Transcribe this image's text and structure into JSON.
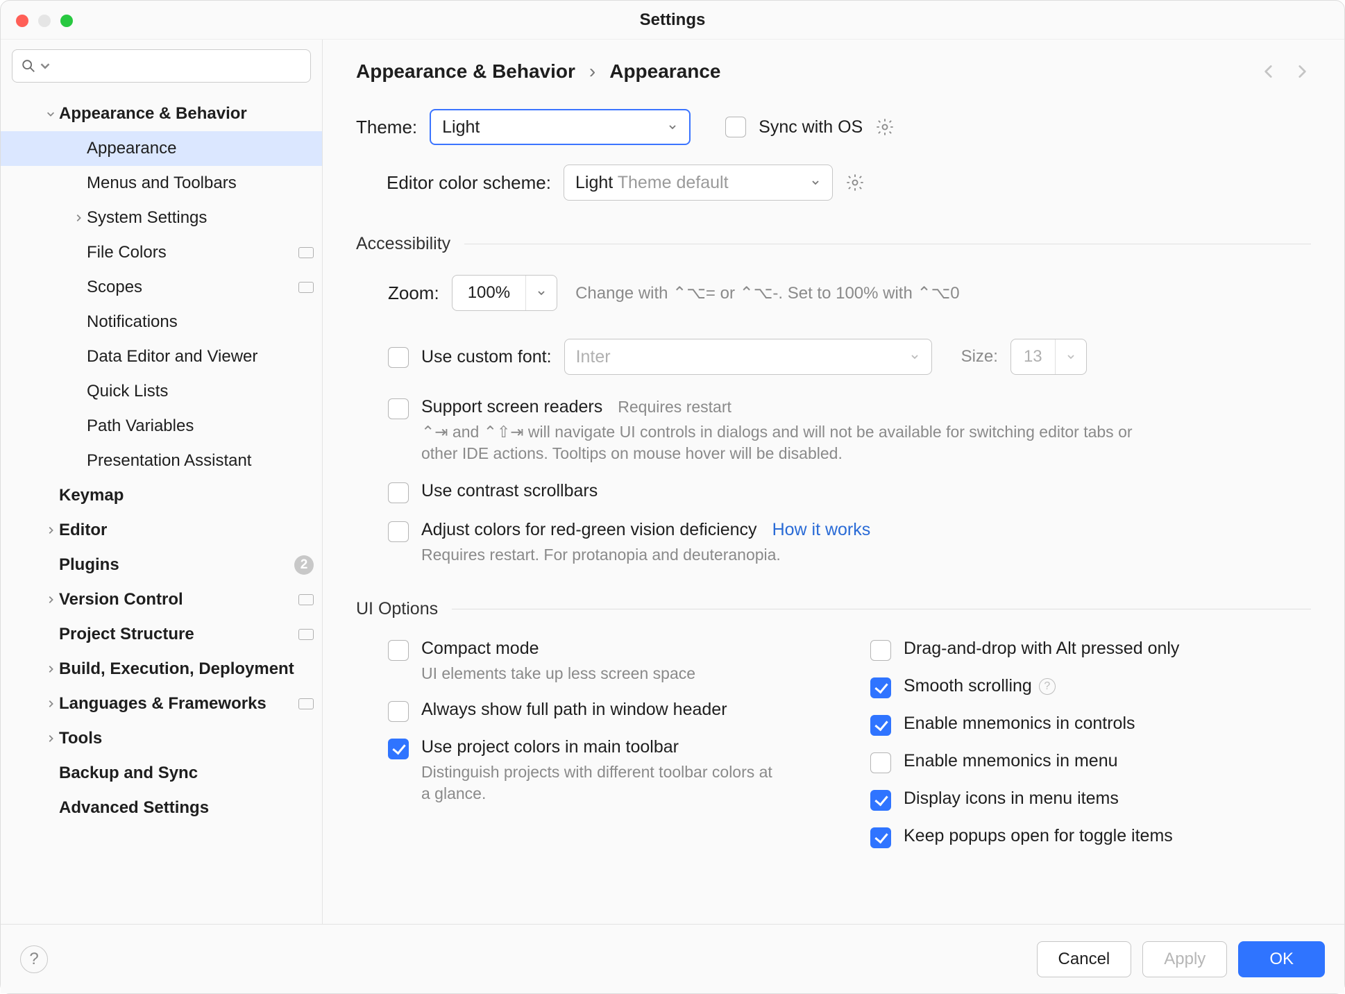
{
  "window": {
    "title": "Settings"
  },
  "search": {
    "placeholder": ""
  },
  "sidebar": [
    {
      "label": "Appearance & Behavior",
      "depth": 1,
      "expanded": true,
      "bold": true,
      "hasChildren": true
    },
    {
      "label": "Appearance",
      "depth": 2,
      "selected": true
    },
    {
      "label": "Menus and Toolbars",
      "depth": 2
    },
    {
      "label": "System Settings",
      "depth": 2,
      "hasChildren": true
    },
    {
      "label": "File Colors",
      "depth": 2,
      "tag": true
    },
    {
      "label": "Scopes",
      "depth": 2,
      "tag": true
    },
    {
      "label": "Notifications",
      "depth": 2
    },
    {
      "label": "Data Editor and Viewer",
      "depth": 2
    },
    {
      "label": "Quick Lists",
      "depth": 2
    },
    {
      "label": "Path Variables",
      "depth": 2
    },
    {
      "label": "Presentation Assistant",
      "depth": 2
    },
    {
      "label": "Keymap",
      "depth": 1,
      "bold": true
    },
    {
      "label": "Editor",
      "depth": 1,
      "bold": true,
      "hasChildren": true
    },
    {
      "label": "Plugins",
      "depth": 1,
      "bold": true,
      "count": "2"
    },
    {
      "label": "Version Control",
      "depth": 1,
      "bold": true,
      "hasChildren": true,
      "tag": true
    },
    {
      "label": "Project Structure",
      "depth": 1,
      "bold": true,
      "tag": true
    },
    {
      "label": "Build, Execution, Deployment",
      "depth": 1,
      "bold": true,
      "hasChildren": true
    },
    {
      "label": "Languages & Frameworks",
      "depth": 1,
      "bold": true,
      "hasChildren": true,
      "tag": true
    },
    {
      "label": "Tools",
      "depth": 1,
      "bold": true,
      "hasChildren": true
    },
    {
      "label": "Backup and Sync",
      "depth": 1,
      "bold": true
    },
    {
      "label": "Advanced Settings",
      "depth": 1,
      "bold": true
    }
  ],
  "breadcrumbs": {
    "a": "Appearance & Behavior",
    "b": "Appearance"
  },
  "theme": {
    "label": "Theme:",
    "value": "Light",
    "sync": "Sync with OS"
  },
  "editorScheme": {
    "label": "Editor color scheme:",
    "value": "Light",
    "suffix": "Theme default"
  },
  "accessibility": {
    "title": "Accessibility",
    "zoomLabel": "Zoom:",
    "zoomValue": "100%",
    "zoomHint": "Change with ⌃⌥= or ⌃⌥-. Set to 100% with ⌃⌥0",
    "customFont": {
      "label": "Use custom font:",
      "font": "Inter",
      "sizeLabel": "Size:",
      "size": "13"
    },
    "screenReaders": {
      "label": "Support screen readers",
      "hint": "Requires restart",
      "desc": "⌃⇥ and ⌃⇧⇥ will navigate UI controls in dialogs and will not be available for switching editor tabs or other IDE actions. Tooltips on mouse hover will be disabled."
    },
    "contrastScrollbars": "Use contrast scrollbars",
    "colorDeficiency": {
      "label": "Adjust colors for red-green vision deficiency",
      "link": "How it works",
      "desc": "Requires restart. For protanopia and deuteranopia."
    }
  },
  "uiOptions": {
    "title": "UI Options",
    "left": [
      {
        "label": "Compact mode",
        "desc": "UI elements take up less screen space",
        "checked": false
      },
      {
        "label": "Always show full path in window header",
        "checked": false
      },
      {
        "label": "Use project colors in main toolbar",
        "desc": "Distinguish projects with different toolbar colors at a glance.",
        "checked": true
      }
    ],
    "right": [
      {
        "label": "Drag-and-drop with Alt pressed only",
        "checked": false
      },
      {
        "label": "Smooth scrolling",
        "checked": true,
        "info": true
      },
      {
        "label": "Enable mnemonics in controls",
        "checked": true
      },
      {
        "label": "Enable mnemonics in menu",
        "checked": false
      },
      {
        "label": "Display icons in menu items",
        "checked": true
      },
      {
        "label": "Keep popups open for toggle items",
        "checked": true
      }
    ]
  },
  "footer": {
    "cancel": "Cancel",
    "apply": "Apply",
    "ok": "OK"
  }
}
